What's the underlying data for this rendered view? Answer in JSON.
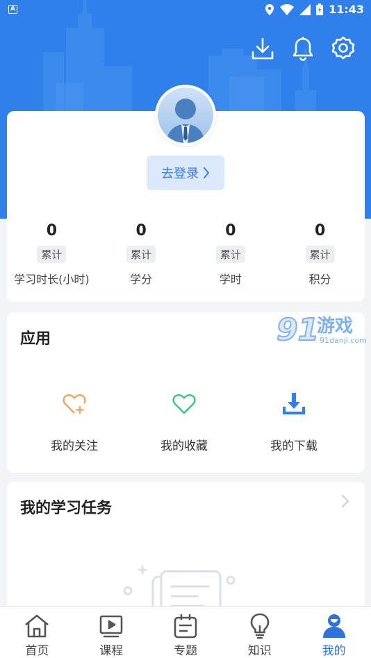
{
  "status_bar": {
    "time": "11:43",
    "left_icon": "A"
  },
  "header": {
    "icons": [
      "download-icon",
      "bell-icon",
      "settings-icon"
    ],
    "color": "#2f80ea"
  },
  "profile": {
    "login_label": "去登录",
    "stats": [
      {
        "value": "0",
        "tag": "累计",
        "label": "学习时长(小时)"
      },
      {
        "value": "0",
        "tag": "累计",
        "label": "学分"
      },
      {
        "value": "0",
        "tag": "累计",
        "label": "学时"
      },
      {
        "value": "0",
        "tag": "累计",
        "label": "积分"
      }
    ]
  },
  "apps": {
    "title": "应用",
    "items": [
      {
        "label": "我的关注",
        "icon": "heart-plus-icon",
        "color": "#f5a25d"
      },
      {
        "label": "我的收藏",
        "icon": "heart-icon",
        "color": "#3cc47c"
      },
      {
        "label": "我的下载",
        "icon": "download-tray-icon",
        "color": "#2f80ea"
      }
    ]
  },
  "watermark": {
    "text": "游戏",
    "sub": "91danji.com"
  },
  "tasks": {
    "title": "我的学习任务"
  },
  "tabbar": {
    "items": [
      {
        "label": "首页",
        "icon": "home-icon"
      },
      {
        "label": "课程",
        "icon": "play-icon"
      },
      {
        "label": "专题",
        "icon": "topic-icon"
      },
      {
        "label": "知识",
        "icon": "bulb-icon"
      },
      {
        "label": "我的",
        "icon": "user-icon",
        "active": true
      }
    ],
    "active_color": "#2f73d8"
  }
}
